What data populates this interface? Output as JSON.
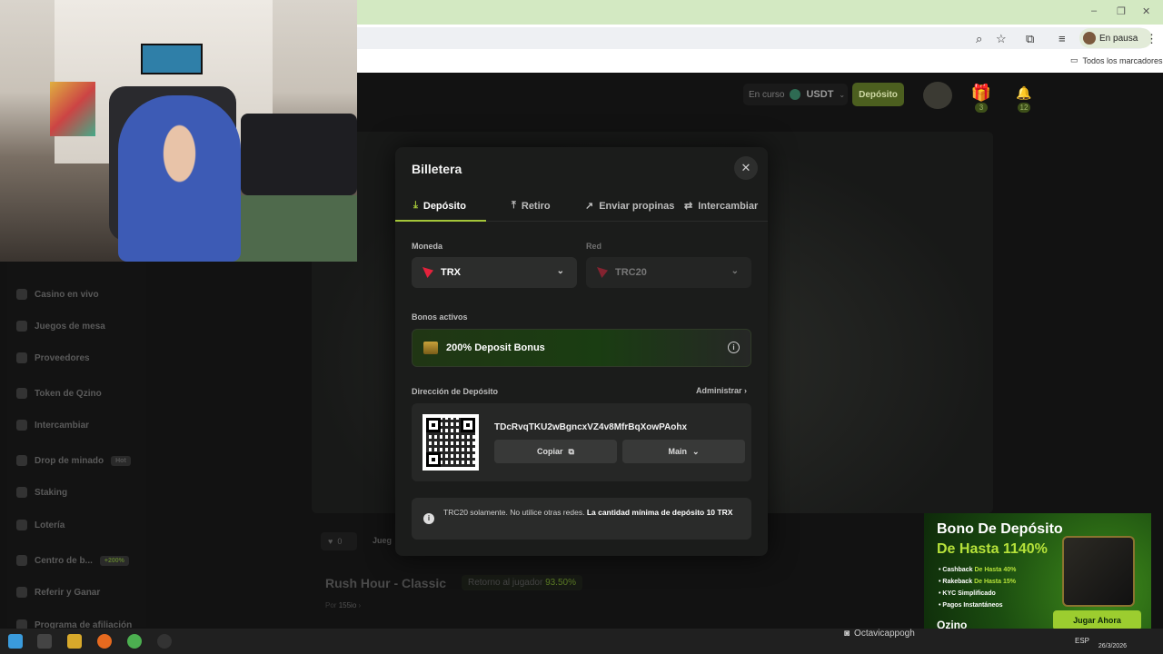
{
  "browser": {
    "profile_label": "En pausa",
    "bookmarks_label": "Todos los marcadores",
    "min_label": "–",
    "max_label": "❐",
    "close_label": "✕"
  },
  "topbar": {
    "status_label": "En curso",
    "currency": "USDT",
    "deposit_button": "Depósito",
    "gift_count": "3",
    "notif_count": "12"
  },
  "sidebar": {
    "items": [
      {
        "label": "Casino en vivo"
      },
      {
        "label": "Juegos de mesa"
      },
      {
        "label": "Proveedores"
      },
      {
        "label": "Token de Qzino"
      },
      {
        "label": "Intercambiar"
      },
      {
        "label": "Drop de minado",
        "tag": "Hot"
      },
      {
        "label": "Staking"
      },
      {
        "label": "Lotería"
      },
      {
        "label": "Centro de b...",
        "tag": "+200%"
      },
      {
        "label": "Referir y Ganar"
      },
      {
        "label": "Programa de afiliación"
      }
    ]
  },
  "game": {
    "likes": "0",
    "juega_label": "Jueg",
    "title": "Rush Hour - Classic",
    "rtp_label": "Retorno al jugador",
    "rtp_value": "93.50%",
    "by_prefix": "Por",
    "provider": "155io"
  },
  "wallet": {
    "title": "Billetera",
    "close_icon": "✕",
    "tabs": [
      {
        "label": "Depósito"
      },
      {
        "label": "Retiro"
      },
      {
        "label": "Enviar propinas"
      },
      {
        "label": "Intercambiar"
      }
    ],
    "currency_label": "Moneda",
    "currency_value": "TRX",
    "network_label": "Red",
    "network_value": "TRC20",
    "bonuses_label": "Bonos activos",
    "bonus_name": "200% Deposit Bonus",
    "address_label": "Dirección de Depósito",
    "manage_label": "Administrar",
    "address": "TDcRvqTKU2wBgncxVZ4v8MfrBqXowPAohx",
    "copy_label": "Copiar",
    "account_label": "Main",
    "notice_text": "TRC20 solamente. No utilice otras redes.",
    "notice_bold": "La cantidad mínima de depósito 10 TRX"
  },
  "promo": {
    "line1": "Bono De Depósito",
    "line2": "De Hasta 1140%",
    "features": [
      {
        "label": "Cashback",
        "value": "De Hasta 40%"
      },
      {
        "label": "Rakeback",
        "value": "De Hasta 15%"
      },
      {
        "label": "KYC Simplificado",
        "value": ""
      },
      {
        "label": "Pagos Instantáneos",
        "value": ""
      }
    ],
    "logo": "Qzino",
    "cta": "Jugar Ahora"
  },
  "stream": {
    "tiktok_handle": "Octavicappogh"
  },
  "taskbar": {
    "lang": "ESP",
    "date": "26/3/2026"
  }
}
